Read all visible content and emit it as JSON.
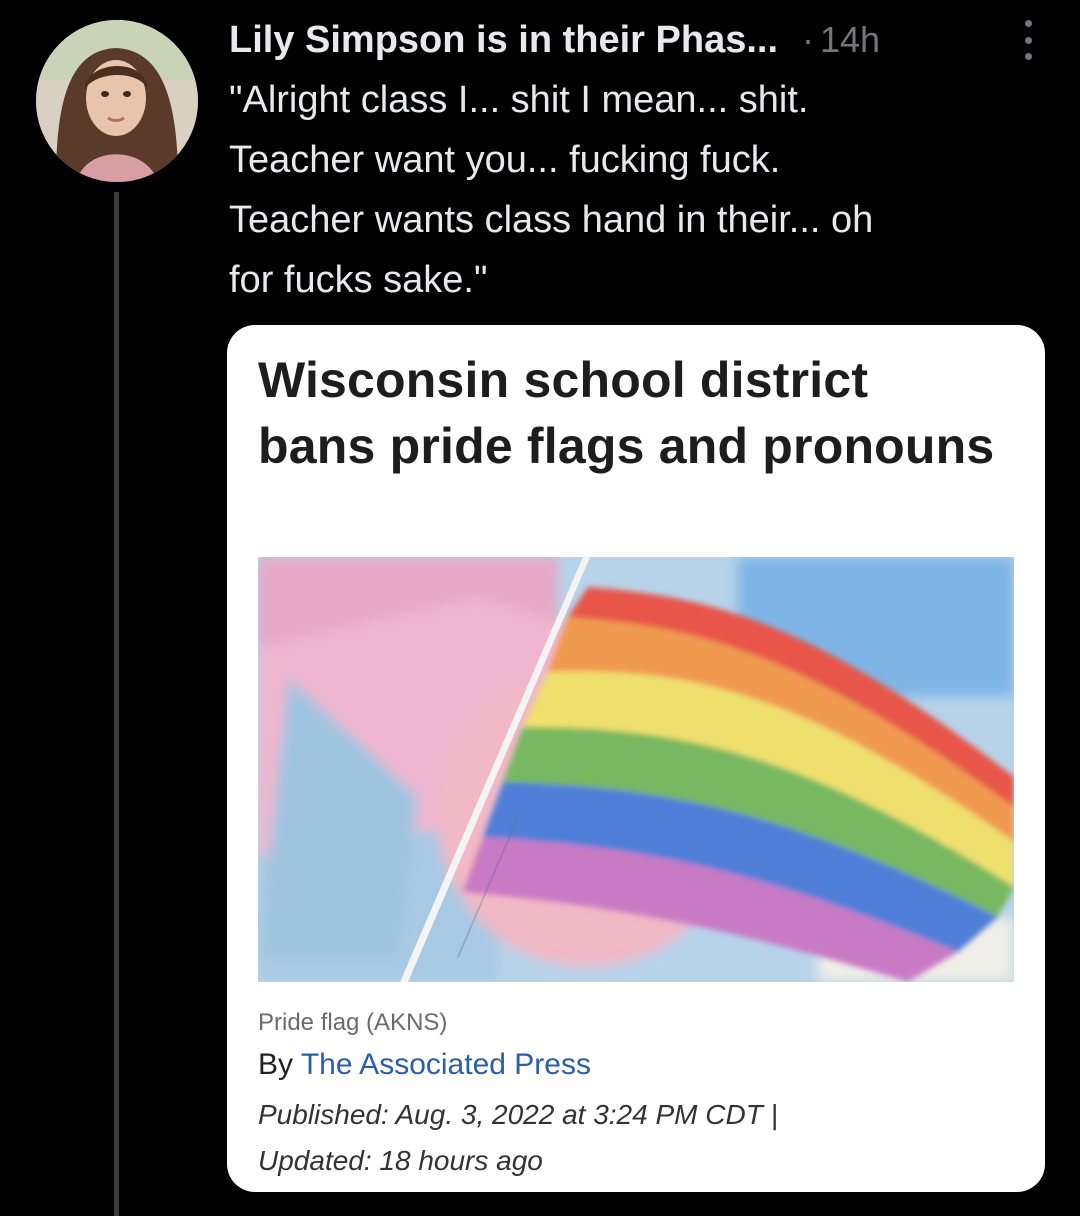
{
  "tweet": {
    "display_name": "Lily Simpson is in their Phas...",
    "separator": "·",
    "time": "14h",
    "text": "\"Alright class I... shit I mean... shit.\nTeacher want you... fucking fuck.\nTeacher wants class hand in their... oh\nfor fucks sake.\""
  },
  "icons": {
    "more": "more-vertical-icon",
    "avatar": "profile-photo"
  },
  "card": {
    "headline": "Wisconsin school district bans pride flags and pronouns",
    "caption": "Pride flag  (AKNS)",
    "byline_prefix": "By ",
    "byline_source": "The Associated Press",
    "published": "Published: Aug. 3, 2022 at 3:24 PM CDT |",
    "updated": "Updated: 18 hours ago"
  },
  "colors": {
    "background": "#000000",
    "text_primary": "#e7e9ea",
    "text_secondary": "#71767b",
    "link": "#2a5ea8",
    "card_bg": "#ffffff"
  }
}
